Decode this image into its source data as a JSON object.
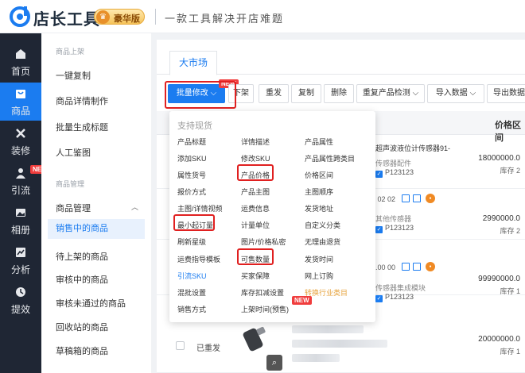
{
  "header": {
    "brand": "店长工具",
    "vip_label": "豪华版",
    "slogan": "一款工具解决开店难题"
  },
  "nav": [
    {
      "label": "首页",
      "icon": "home-icon",
      "active": false
    },
    {
      "label": "商品",
      "icon": "goods-icon",
      "active": true
    },
    {
      "label": "装修",
      "icon": "decorate-icon",
      "active": false
    },
    {
      "label": "引流",
      "icon": "traffic-icon",
      "active": false,
      "badge": "NEW"
    },
    {
      "label": "相册",
      "icon": "album-icon",
      "active": false
    },
    {
      "label": "分析",
      "icon": "analysis-icon",
      "active": false
    },
    {
      "label": "提效",
      "icon": "efficiency-icon",
      "active": false
    }
  ],
  "menu2": {
    "group1": "商品上架",
    "group1_items": [
      "一键复制",
      "商品详情制作",
      "批量生成标题",
      "人工鉴图"
    ],
    "group2": "商品管理",
    "parent": "商品管理",
    "sub_items": [
      "销售中的商品",
      "待上架的商品",
      "审核中的商品",
      "审核未通过的商品",
      "回收站的商品",
      "草稿箱的商品"
    ]
  },
  "main": {
    "tab": "大市场",
    "toolbar": {
      "batch_edit": "批量修改",
      "new_badge": "NEW",
      "delist": "下架",
      "republish": "重发",
      "copy": "复制",
      "delete": "删除",
      "recheck": "重复产品检测",
      "import": "导入数据",
      "export": "导出数据"
    },
    "price_header": "价格区间"
  },
  "rows": [
    {
      "title": "超声波液位计传感器91-",
      "cat": "传感器配件",
      "pid": "P123123",
      "price": "18000000.0",
      "stock": "库存 2"
    },
    {
      "date": "5 02 02",
      "cat": "其他传感器",
      "pid": "P123123",
      "price": "2990000.0",
      "stock": "库存 2"
    },
    {
      "date": "7.00 00",
      "cat": "传感器集成模块",
      "pid": "P123123",
      "price": "99990000.0",
      "stock": "库存 1"
    },
    {
      "status": "已重发",
      "price": "20000000.0",
      "stock": "库存 1"
    }
  ],
  "dropdown": {
    "header": "支持现货",
    "col1": [
      "产品标题",
      "添加SKU",
      "属性货号",
      "报价方式",
      "主图/详情视频",
      "最小起订量",
      "刷新星级",
      "运费指导模板",
      "引流SKU",
      "混批设置",
      "销售方式"
    ],
    "col2": [
      "详情描述",
      "修改SKU",
      "产品价格",
      "产品主图",
      "运费信息",
      "计量单位",
      "图片/价格私密",
      "可售数量",
      "买家保障",
      "库存扣减设置",
      "上架时间(预售)"
    ],
    "col3": [
      "产品属性",
      "产品属性跨类目",
      "价格区间",
      "主图顺序",
      "发货地址",
      "自定义分类",
      "无理由退货",
      "发货时间",
      "网上订购",
      "转换行业类目"
    ],
    "new_badge": "NEW"
  },
  "colors": {
    "accent": "#1b7cf0",
    "highlight_box": "#e02020",
    "nav_bg": "#1f2634"
  }
}
